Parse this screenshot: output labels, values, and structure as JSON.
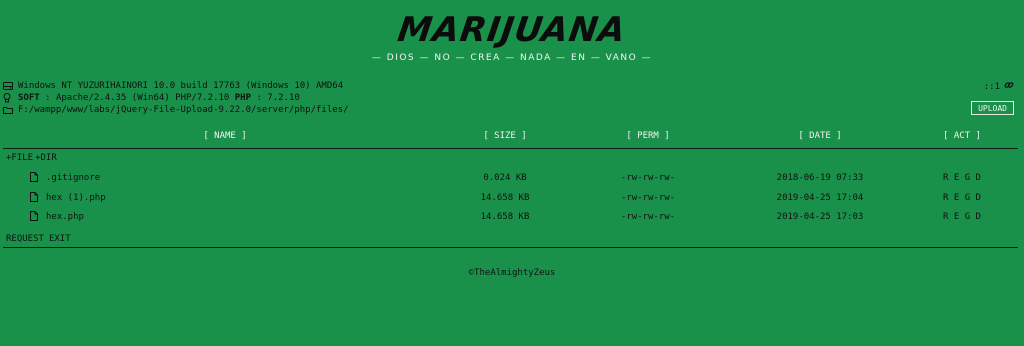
{
  "header": {
    "logo": "MARIJUANA",
    "tagline": "— DIOS — NO — CREA — NADA — EN — VANO —"
  },
  "info": {
    "system": "Windows NT YUZURIHAINORI 10.0 build 17763 (Windows 10) AMD64",
    "soft_label": "SOFT",
    "soft_value": ": Apache/2.4.35 (Win64) PHP/7.2.10",
    "php_label": "PHP",
    "php_value": ": 7.2.10",
    "path": "F:/wampp/www/labs/jQuery-File-Upload-9.22.0/server/php/files/",
    "address": "::1",
    "upload_label": "UPLOAD",
    "icons": {
      "system": "drive-icon",
      "soft": "bulb-icon",
      "path": "folder-icon",
      "address": "link-icon",
      "file": "file-icon"
    }
  },
  "table": {
    "columns": {
      "name": "[ NAME ]",
      "size": "[ SIZE ]",
      "perm": "[ PERM ]",
      "date": "[ DATE ]",
      "act": "[ ACT ]"
    },
    "new_file": "+FILE",
    "new_dir": "+DIR",
    "files": [
      {
        "name": ".gitignore",
        "size": "0.024 KB",
        "perm": "-rw-rw-rw-",
        "date": "2018-06-19 07:33",
        "act": "R E G D"
      },
      {
        "name": "hex (1).php",
        "size": "14.658 KB",
        "perm": "-rw-rw-rw-",
        "date": "2019-04-25 17:04",
        "act": "R E G D"
      },
      {
        "name": "hex.php",
        "size": "14.658 KB",
        "perm": "-rw-rw-rw-",
        "date": "2019-04-25 17:03",
        "act": "R E G D"
      }
    ]
  },
  "footer": {
    "request": "REQUEST",
    "exit": "EXIT",
    "credit": "©TheAlmightyZeus"
  },
  "colors": {
    "background": "#1a914b",
    "light_text": "#f2f2f2",
    "dark_text": "#111111"
  }
}
